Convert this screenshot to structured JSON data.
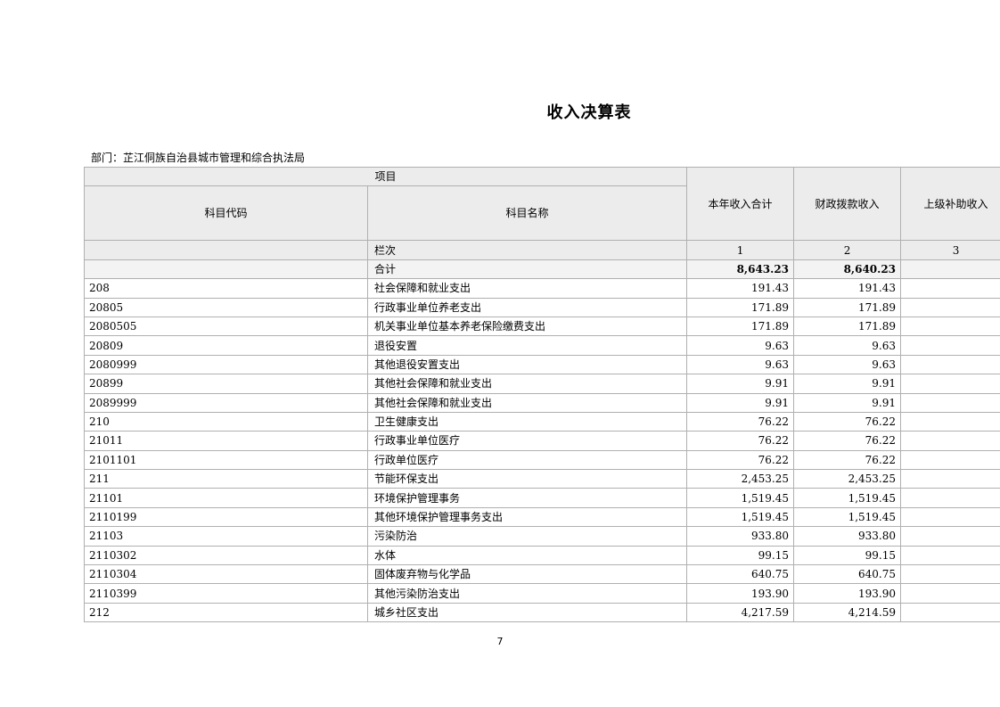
{
  "title": "收入决算表",
  "department": "部门：芷江侗族自治县城市管理和综合执法局",
  "header": {
    "project": "项目",
    "code": "科目代码",
    "name": "科目名称",
    "col1": "本年收入合计",
    "col2": "财政拨款收入",
    "col3": "上级补助收入",
    "index_label": "栏次",
    "index1": "1",
    "index2": "2",
    "index3": "3"
  },
  "total": {
    "label": "合计",
    "c1": "8,643.23",
    "c2": "8,640.23",
    "c3": ""
  },
  "rows": [
    {
      "code": "208",
      "name": "社会保障和就业支出",
      "c1": "191.43",
      "c2": "191.43",
      "c3": ""
    },
    {
      "code": "20805",
      "name": "行政事业单位养老支出",
      "c1": "171.89",
      "c2": "171.89",
      "c3": ""
    },
    {
      "code": "2080505",
      "name": "机关事业单位基本养老保险缴费支出",
      "c1": "171.89",
      "c2": "171.89",
      "c3": ""
    },
    {
      "code": "20809",
      "name": "退役安置",
      "c1": "9.63",
      "c2": "9.63",
      "c3": ""
    },
    {
      "code": "2080999",
      "name": "其他退役安置支出",
      "c1": "9.63",
      "c2": "9.63",
      "c3": ""
    },
    {
      "code": "20899",
      "name": "其他社会保障和就业支出",
      "c1": "9.91",
      "c2": "9.91",
      "c3": ""
    },
    {
      "code": "2089999",
      "name": "其他社会保障和就业支出",
      "c1": "9.91",
      "c2": "9.91",
      "c3": ""
    },
    {
      "code": "210",
      "name": "卫生健康支出",
      "c1": "76.22",
      "c2": "76.22",
      "c3": ""
    },
    {
      "code": "21011",
      "name": "行政事业单位医疗",
      "c1": "76.22",
      "c2": "76.22",
      "c3": ""
    },
    {
      "code": "2101101",
      "name": "行政单位医疗",
      "c1": "76.22",
      "c2": "76.22",
      "c3": ""
    },
    {
      "code": "211",
      "name": "节能环保支出",
      "c1": "2,453.25",
      "c2": "2,453.25",
      "c3": ""
    },
    {
      "code": "21101",
      "name": "环境保护管理事务",
      "c1": "1,519.45",
      "c2": "1,519.45",
      "c3": ""
    },
    {
      "code": "2110199",
      "name": "其他环境保护管理事务支出",
      "c1": "1,519.45",
      "c2": "1,519.45",
      "c3": ""
    },
    {
      "code": "21103",
      "name": "污染防治",
      "c1": "933.80",
      "c2": "933.80",
      "c3": ""
    },
    {
      "code": "2110302",
      "name": "水体",
      "c1": "99.15",
      "c2": "99.15",
      "c3": ""
    },
    {
      "code": "2110304",
      "name": "固体废弃物与化学品",
      "c1": "640.75",
      "c2": "640.75",
      "c3": ""
    },
    {
      "code": "2110399",
      "name": "其他污染防治支出",
      "c1": "193.90",
      "c2": "193.90",
      "c3": ""
    },
    {
      "code": "212",
      "name": "城乡社区支出",
      "c1": "4,217.59",
      "c2": "4,214.59",
      "c3": ""
    }
  ],
  "page_number": "7"
}
